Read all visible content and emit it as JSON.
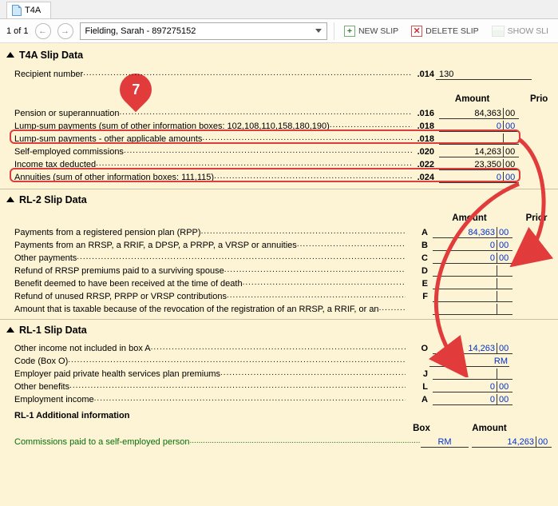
{
  "tab": {
    "label": "T4A"
  },
  "toolbar": {
    "pager": "1 of 1",
    "recipient": "Fielding, Sarah - 897275152",
    "newSlip": "NEW SLIP",
    "deleteSlip": "DELETE SLIP",
    "showSlip": "SHOW SLI"
  },
  "callout": "7",
  "t4a": {
    "title": "T4A Slip Data",
    "recipientNumberLabel": "Recipient number",
    "recipientNumberBox": ".014",
    "recipientNumberValue": "130",
    "amountHeader": "Amount",
    "priorHeader": "Prio",
    "rows": [
      {
        "label": "Pension or superannuation",
        "box": ".016",
        "int": "84,363",
        "cents": "00",
        "blue": false
      },
      {
        "label": "Lump-sum payments (sum of other information boxes: 102,108,110,158,180,190)",
        "box": ".018",
        "int": "0",
        "cents": "00",
        "blue": true
      },
      {
        "label": "Lump-sum payments - other applicable amounts",
        "box": ".018",
        "int": "",
        "cents": "",
        "blue": false
      },
      {
        "label": "Self-employed commissions",
        "box": ".020",
        "int": "14,263",
        "cents": "00",
        "blue": false
      },
      {
        "label": "Income tax deducted",
        "box": ".022",
        "int": "23,350",
        "cents": "00",
        "blue": false
      },
      {
        "label": "Annuities (sum of other information boxes: 111,115)",
        "box": ".024",
        "int": "0",
        "cents": "00",
        "blue": true
      }
    ]
  },
  "rl2": {
    "title": "RL-2 Slip Data",
    "amountHeader": "Amount",
    "priorHeader": "Prior",
    "rows": [
      {
        "label": "Payments from a registered pension plan (RPP)",
        "box": "A",
        "int": "84,363",
        "cents": "00",
        "blue": true
      },
      {
        "label": "Payments from an RRSP, a RRIF, a DPSP, a PRPP, a VRSP or annuities",
        "box": "B",
        "int": "0",
        "cents": "00",
        "blue": true
      },
      {
        "label": "Other payments",
        "box": "C",
        "int": "0",
        "cents": "00",
        "blue": true
      },
      {
        "label": "Refund of RRSP premiums paid to a surviving spouse",
        "box": "D",
        "int": "",
        "cents": "",
        "blue": false
      },
      {
        "label": "Benefit deemed to have been received at the time of death",
        "box": "E",
        "int": "",
        "cents": "",
        "blue": false
      },
      {
        "label": "Refund of unused RRSP, PRPP or VRSP contributions",
        "box": "F",
        "int": "",
        "cents": "",
        "blue": false
      },
      {
        "label": "Amount that is taxable because of the revocation of the registration of an RRSP, a RRIF, or an",
        "box": "",
        "int": "",
        "cents": "",
        "blue": false
      }
    ]
  },
  "rl1": {
    "title": "RL-1 Slip Data",
    "rows": [
      {
        "label": "Other income not included in box A",
        "box": "O",
        "int": "14,263",
        "cents": "00",
        "blue": true
      },
      {
        "label": "Code (Box O)",
        "box": "",
        "code": "RM",
        "blue": true
      },
      {
        "label": "Employer paid private health services plan premiums",
        "box": "J",
        "int": "",
        "cents": "",
        "blue": false
      },
      {
        "label": "Other benefits",
        "box": "L",
        "int": "0",
        "cents": "00",
        "blue": true
      },
      {
        "label": "Employment income",
        "box": "A",
        "int": "0",
        "cents": "00",
        "blue": true
      }
    ],
    "addl": {
      "header": "RL-1 Additional information",
      "boxHeader": "Box",
      "amountHeader": "Amount",
      "label": "Commissions paid to a self-employed person",
      "box": "RM",
      "int": "14,263",
      "cents": "00"
    }
  }
}
